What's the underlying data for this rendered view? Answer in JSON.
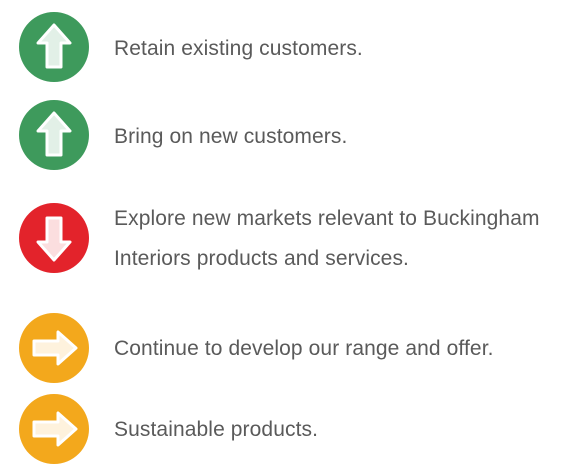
{
  "colors": {
    "up": "#3e9a5c",
    "down": "#e3232b",
    "side": "#f3a81c",
    "text": "#5a5a5a"
  },
  "items": [
    {
      "icon": "arrow-up-icon",
      "status": "up",
      "lines": [
        "Retain existing customers."
      ]
    },
    {
      "icon": "arrow-up-icon",
      "status": "up",
      "lines": [
        "Bring on new customers."
      ]
    },
    {
      "icon": "arrow-down-icon",
      "status": "down",
      "lines": [
        "Explore new markets relevant to Buckingham",
        "Interiors products and services."
      ]
    },
    {
      "icon": "arrow-right-icon",
      "status": "side",
      "lines": [
        "Continue to develop our range and offer."
      ]
    },
    {
      "icon": "arrow-right-icon",
      "status": "side",
      "lines": [
        "Sustainable products."
      ]
    }
  ]
}
